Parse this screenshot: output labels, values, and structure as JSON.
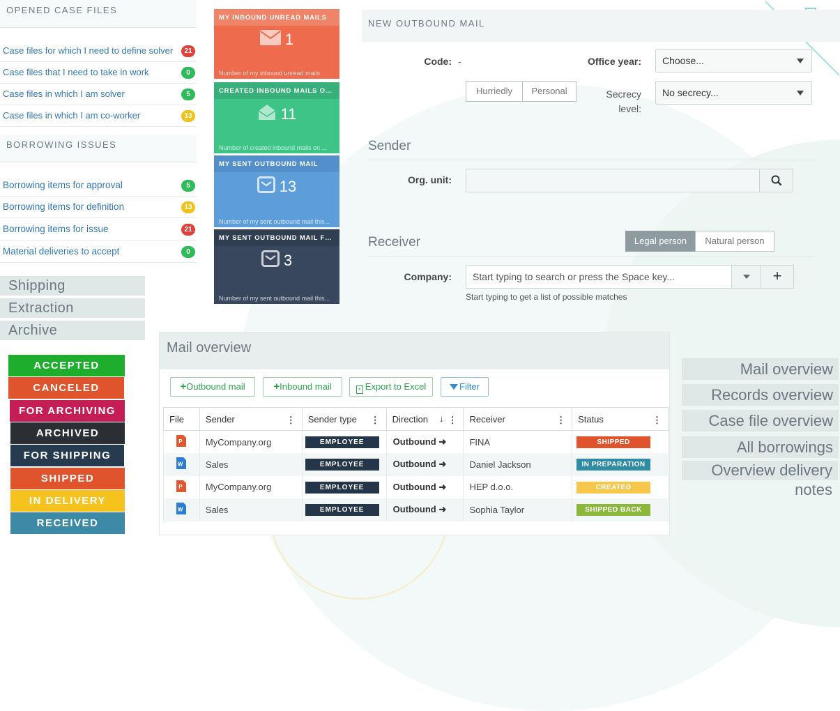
{
  "case_files": {
    "title": "OPENED CASE FILES",
    "items": [
      {
        "label": "Case files for which I need to define solver",
        "count": "21",
        "color": "red"
      },
      {
        "label": "Case files that I need to take in work",
        "count": "0",
        "color": "green"
      },
      {
        "label": "Case files in which I am solver",
        "count": "5",
        "color": "green"
      },
      {
        "label": "Case files in which I am co-worker",
        "count": "13",
        "color": "yellow"
      }
    ]
  },
  "borrowing": {
    "title": "BORROWING ISSUES",
    "items": [
      {
        "label": "Borrowing items for approval",
        "count": "5",
        "color": "green"
      },
      {
        "label": "Borrowing items for definition",
        "count": "13",
        "color": "yellow"
      },
      {
        "label": "Borrowing items for issue",
        "count": "21",
        "color": "red"
      },
      {
        "label": "Material deliveries to accept",
        "count": "0",
        "color": "green"
      }
    ]
  },
  "left_links": [
    "Shipping",
    "Extraction",
    "Archive"
  ],
  "status_buttons": [
    {
      "label": "ACCEPTED",
      "color": "#1fad2e"
    },
    {
      "label": "CANCELED",
      "color": "#e0542d"
    },
    {
      "label": "FOR ARCHIVING",
      "color": "#c51e56"
    },
    {
      "label": "ARCHIVED",
      "color": "#2b2f33"
    },
    {
      "label": "FOR SHIPPING",
      "color": "#263a50"
    },
    {
      "label": "SHIPPED",
      "color": "#e0542d"
    },
    {
      "label": "IN DELIVERY",
      "color": "#f6c21e"
    },
    {
      "label": "RECEIVED",
      "color": "#3d8aa6"
    }
  ],
  "tiles": [
    {
      "title": "MY INBOUND UNREAD MAILS",
      "value": "1",
      "footer": "Number of my inbound unread mails",
      "color": "#ee6b4d",
      "head_color": "#f08468",
      "icon": "envelope-icon"
    },
    {
      "title": "CREATED INBOUND MAILS ON ...",
      "value": "11",
      "footer": "Number of created inbound mails on ...",
      "color": "#3ec487",
      "head_color": "#37b07a",
      "icon": "open-envelope-icon"
    },
    {
      "title": "MY SENT OUTBOUND MAIL",
      "value": "13",
      "footer": "Number of my sent outbound mail this...",
      "color": "#5d9dd9",
      "head_color": "#5390cb",
      "icon": "envelope-square-icon"
    },
    {
      "title": "MY SENT OUTBOUND MAIL FRO...",
      "value": "3",
      "footer": "Number of my sent outbound mail this...",
      "color": "#38475d",
      "head_color": "#303e52",
      "icon": "envelope-square-icon"
    }
  ],
  "form": {
    "title": "NEW OUTBOUND MAIL",
    "code_label": "Code:",
    "code_value": "-",
    "office_year_label": "Office year:",
    "office_year_value": "Choose...",
    "toggle_hurriedly": "Hurriedly",
    "toggle_personal": "Personal",
    "secrecy_label_1": "Secrecy",
    "secrecy_label_2": "level:",
    "secrecy_value": "No secrecy...",
    "sender_title": "Sender",
    "org_unit_label": "Org. unit:",
    "receiver_title": "Receiver",
    "legal_person": "Legal person",
    "natural_person": "Natural person",
    "company_label": "Company:",
    "company_placeholder": "Start typing to search or press the Space key...",
    "company_hint": "Start typing to get a list of possible matches"
  },
  "mail_overview": {
    "title": "Mail overview",
    "toolbar": {
      "outbound": "Outbound mail",
      "inbound": "Inbound mail",
      "export": "Export to Excel",
      "filter": "Filter"
    },
    "columns": [
      "File",
      "Sender",
      "Sender type",
      "Direction",
      "Receiver",
      "Status"
    ],
    "rows": [
      {
        "file": "pdf",
        "sender": "MyCompany.org",
        "sender_type": "EMPLOYEE",
        "direction": "Outbound",
        "receiver": "FINA",
        "status": "SHIPPED",
        "status_color": "#e0542d"
      },
      {
        "file": "word",
        "sender": "Sales",
        "sender_type": "EMPLOYEE",
        "direction": "Outbound",
        "receiver": "Daniel Jackson",
        "status": "IN PREPARATION",
        "status_color": "#2e8ca6"
      },
      {
        "file": "pdf",
        "sender": "MyCompany.org",
        "sender_type": "EMPLOYEE",
        "direction": "Outbound",
        "receiver": "HEP d.o.o.",
        "status": "CREATED",
        "status_color": "#f6c74a"
      },
      {
        "file": "word",
        "sender": "Sales",
        "sender_type": "EMPLOYEE",
        "direction": "Outbound",
        "receiver": "Sophia Taylor",
        "status": "SHIPPED BACK",
        "status_color": "#8cb83a"
      }
    ]
  },
  "right_links": [
    "Mail overview",
    "Records overview",
    "Case file overview",
    "All borrowings",
    "Overview delivery notes"
  ]
}
